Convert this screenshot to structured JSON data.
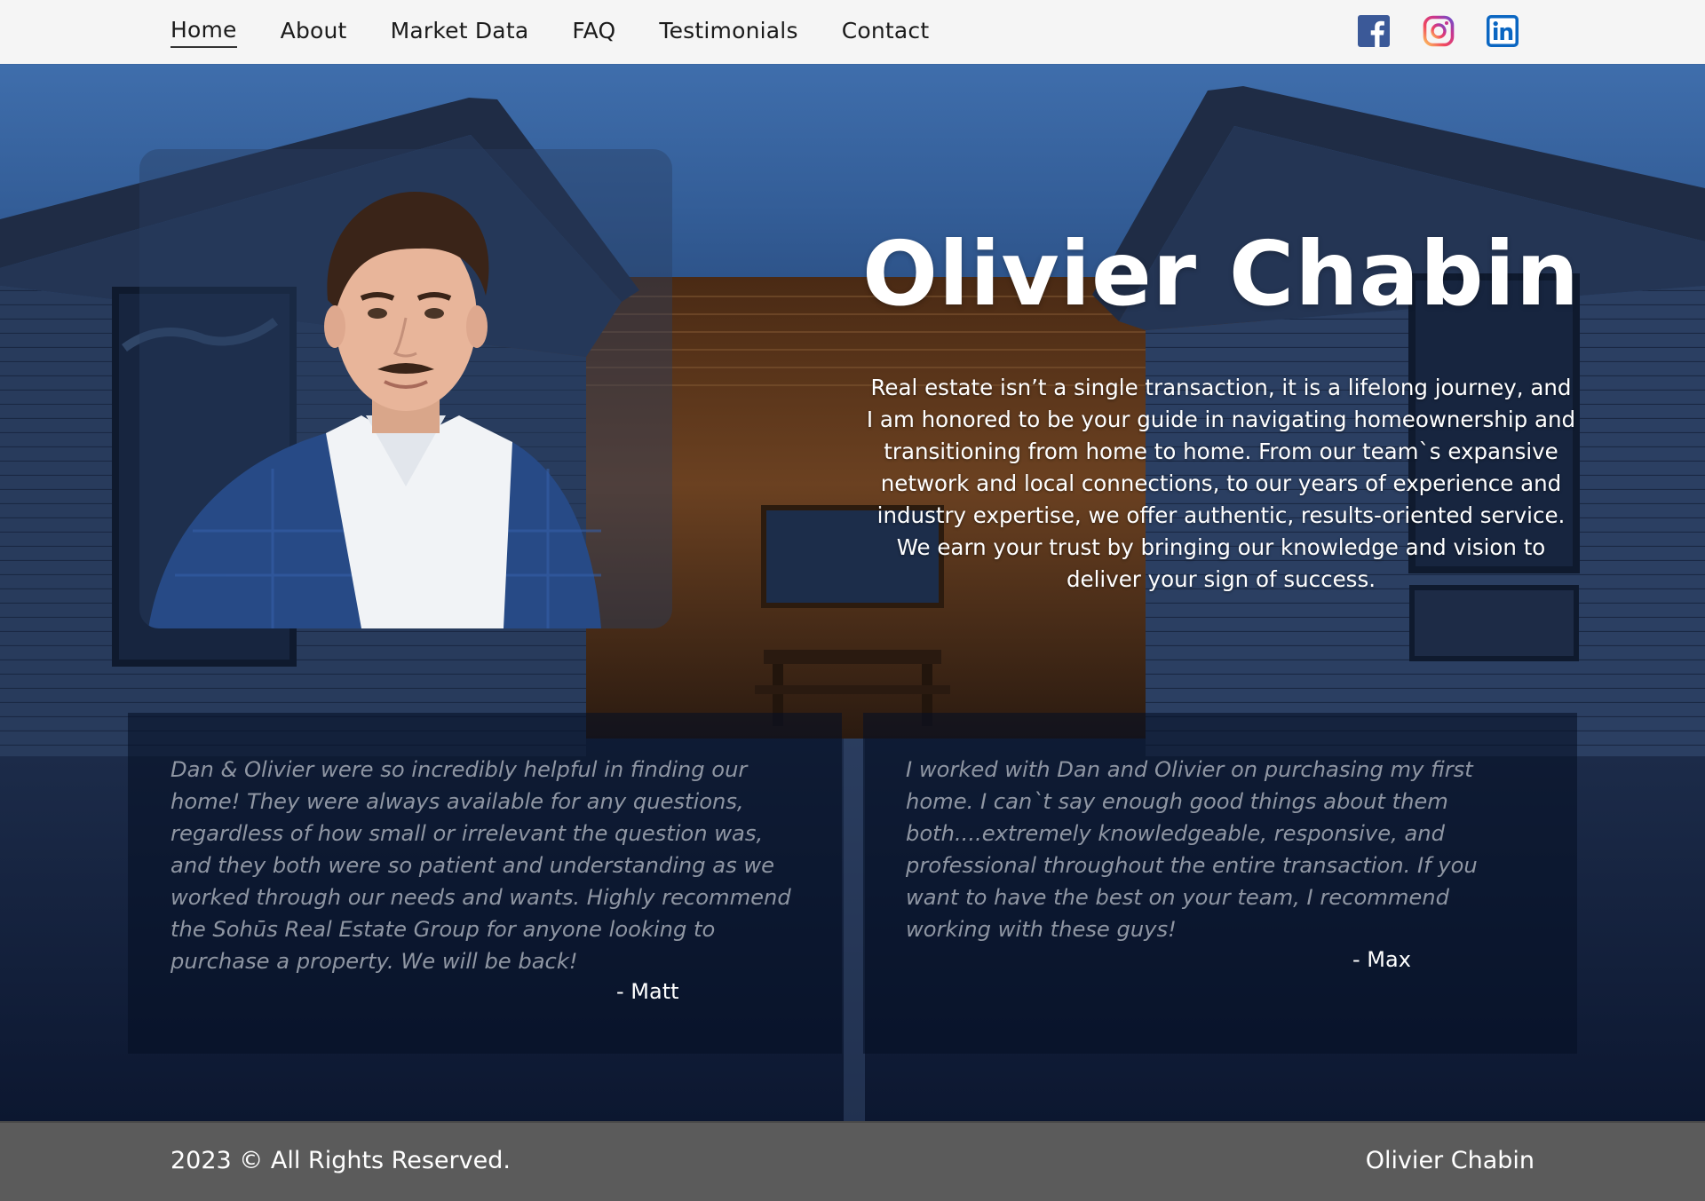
{
  "nav": {
    "items": [
      {
        "label": "Home",
        "active": true
      },
      {
        "label": "About"
      },
      {
        "label": "Market Data"
      },
      {
        "label": "FAQ"
      },
      {
        "label": "Testimonials"
      },
      {
        "label": "Contact"
      }
    ],
    "social": [
      {
        "icon": "facebook-icon",
        "color": "#3b5998"
      },
      {
        "icon": "instagram-icon",
        "color": "#d6249f"
      },
      {
        "icon": "linkedin-icon",
        "color": "#0a66c2"
      }
    ]
  },
  "hero": {
    "title": "Olivier Chabin",
    "intro": "Real estate isn’t a single transaction, it is a lifelong journey, and I am honored to be your guide in navigating homeownership and transitioning from home to home. From our team`s expansive network and local connections, to our years of experience and industry expertise, we offer authentic, results-oriented service. We earn your trust by bringing our knowledge and vision to deliver your sign of success."
  },
  "testimonials": [
    {
      "quote": "Dan & Olivier were so incredibly helpful in finding our home! They were always available for any questions, regardless of how small or irrelevant the question was, and they both were so patient and understanding as we worked through our needs and wants. Highly recommend the Sohūs Real Estate Group for anyone looking to purchase a property. We will be back!",
      "author": "- Matt"
    },
    {
      "quote": "I worked with Dan and Olivier on purchasing my first home. I can`t say enough good things about them both....extremely knowledgeable, responsive, and professional throughout the entire transaction. If you want to have the best on your team, I recommend working with these guys!",
      "author": "- Max"
    }
  ],
  "footer": {
    "copyright": "2023 © All Rights Reserved.",
    "name": "Olivier Chabin"
  },
  "colors": {
    "nav_bg": "#f5f5f5",
    "footer_bg": "#5b5b5b",
    "hero_sky": "#3f6eac"
  }
}
